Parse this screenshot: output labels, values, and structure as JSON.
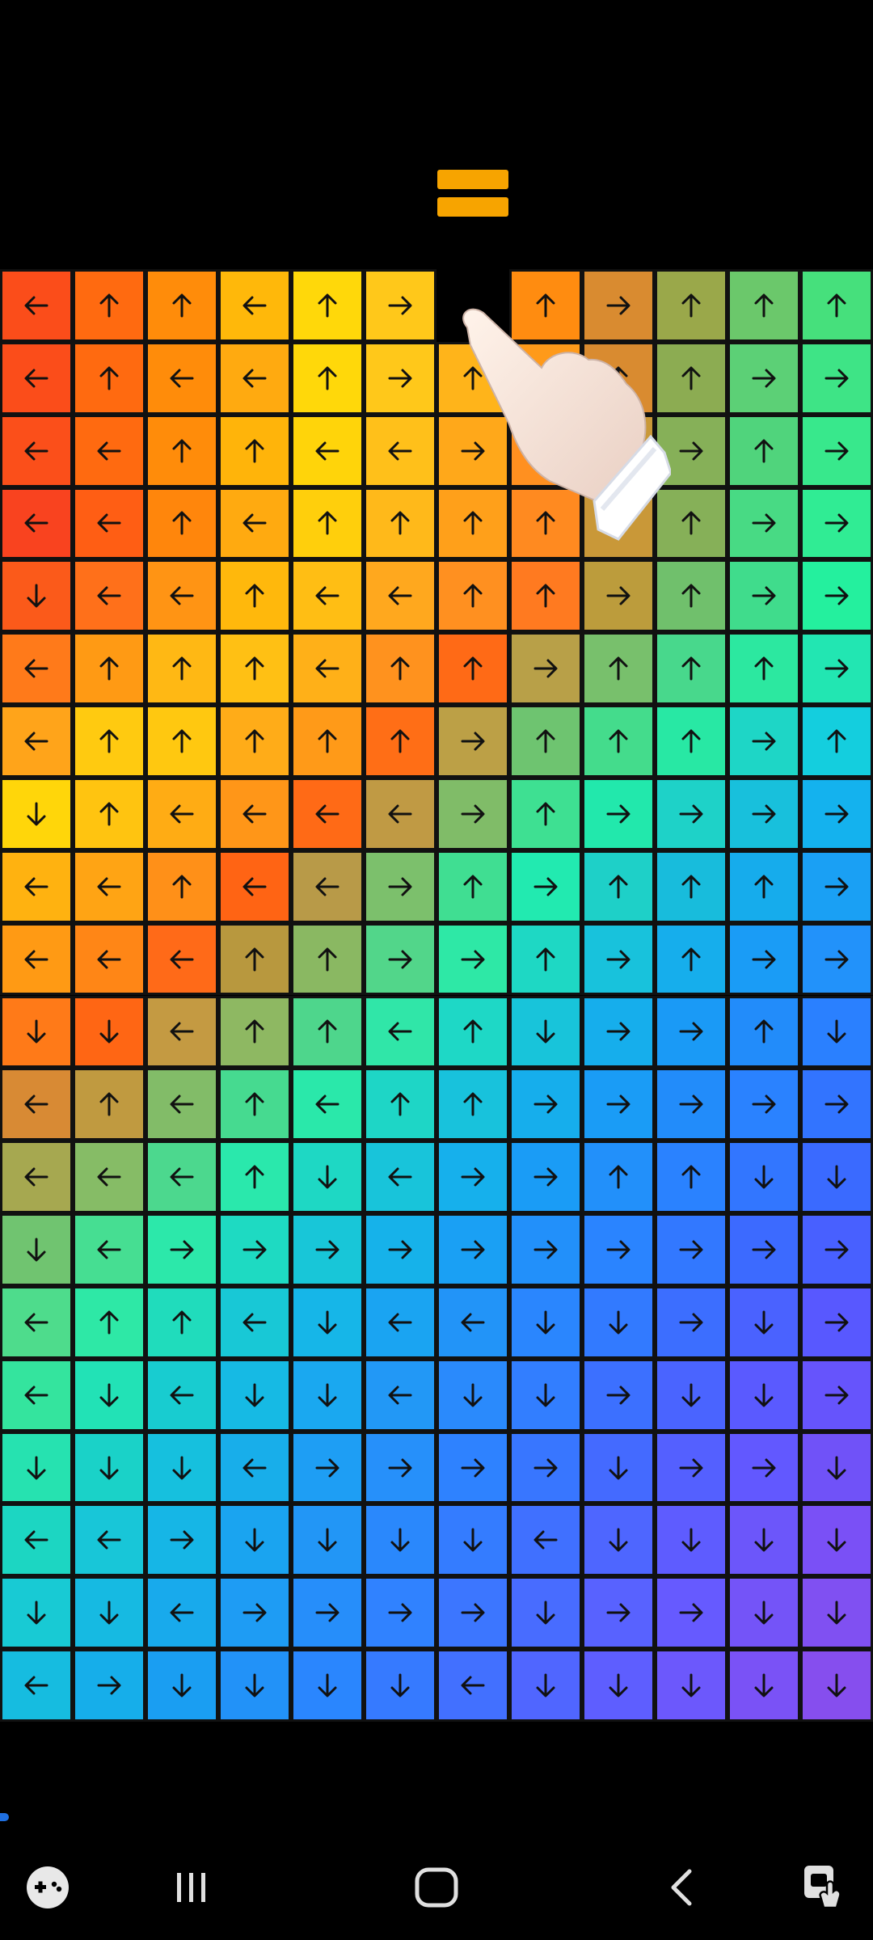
{
  "game": {
    "pause_icon": "pause-icon",
    "progress": 0.01,
    "hint_icon": "pointing-hand-icon",
    "grid": {
      "rows": 20,
      "cols": 12,
      "empty_cell": [
        0,
        6
      ],
      "arrows": [
        [
          "L",
          "U",
          "U",
          "L",
          "U",
          "R",
          "",
          "U",
          "R",
          "U",
          "U",
          "U"
        ],
        [
          "L",
          "U",
          "L",
          "L",
          "U",
          "R",
          "U",
          "U",
          "U",
          "U",
          "R",
          "R"
        ],
        [
          "L",
          "L",
          "U",
          "U",
          "L",
          "L",
          "R",
          "U",
          "L",
          "R",
          "U",
          "R"
        ],
        [
          "L",
          "L",
          "U",
          "L",
          "U",
          "U",
          "U",
          "U",
          "R",
          "U",
          "R",
          "R"
        ],
        [
          "D",
          "L",
          "L",
          "U",
          "L",
          "L",
          "U",
          "U",
          "R",
          "U",
          "R",
          "R"
        ],
        [
          "L",
          "U",
          "U",
          "U",
          "L",
          "U",
          "U",
          "R",
          "U",
          "U",
          "U",
          "R"
        ],
        [
          "L",
          "U",
          "U",
          "U",
          "U",
          "U",
          "R",
          "U",
          "U",
          "U",
          "R",
          "U"
        ],
        [
          "D",
          "U",
          "L",
          "L",
          "L",
          "L",
          "R",
          "U",
          "R",
          "R",
          "R",
          "R"
        ],
        [
          "L",
          "L",
          "U",
          "L",
          "L",
          "R",
          "U",
          "R",
          "U",
          "U",
          "U",
          "R"
        ],
        [
          "L",
          "L",
          "L",
          "U",
          "U",
          "R",
          "R",
          "U",
          "R",
          "U",
          "R",
          "R"
        ],
        [
          "D",
          "D",
          "L",
          "U",
          "U",
          "L",
          "U",
          "D",
          "R",
          "R",
          "U",
          "D"
        ],
        [
          "L",
          "U",
          "L",
          "U",
          "L",
          "U",
          "U",
          "R",
          "R",
          "R",
          "R",
          "R"
        ],
        [
          "L",
          "L",
          "L",
          "U",
          "D",
          "L",
          "R",
          "R",
          "U",
          "U",
          "D",
          "D"
        ],
        [
          "D",
          "L",
          "R",
          "R",
          "R",
          "R",
          "R",
          "R",
          "R",
          "R",
          "R",
          "R"
        ],
        [
          "L",
          "U",
          "U",
          "L",
          "D",
          "L",
          "L",
          "D",
          "D",
          "R",
          "D",
          "R"
        ],
        [
          "L",
          "D",
          "L",
          "D",
          "D",
          "L",
          "D",
          "D",
          "R",
          "D",
          "D",
          "R"
        ],
        [
          "D",
          "D",
          "D",
          "L",
          "R",
          "R",
          "R",
          "R",
          "D",
          "R",
          "R",
          "D"
        ],
        [
          "L",
          "L",
          "R",
          "D",
          "D",
          "D",
          "D",
          "L",
          "D",
          "D",
          "D",
          "D"
        ],
        [
          "D",
          "D",
          "L",
          "R",
          "R",
          "R",
          "R",
          "D",
          "R",
          "R",
          "D",
          "D"
        ],
        [
          "L",
          "R",
          "D",
          "D",
          "D",
          "D",
          "L",
          "D",
          "D",
          "D",
          "D",
          "D"
        ]
      ],
      "colors": [
        [
          "#fb4d1a",
          "#ff6a10",
          "#ff8c0a",
          "#ffb80a",
          "#ffd80a",
          "#ffc81a",
          "",
          "#ff8c10",
          "#d98b30",
          "#9aa84a",
          "#6bc86b",
          "#46e07c"
        ],
        [
          "#fb4d1a",
          "#ff6a10",
          "#ff8c0a",
          "#ffaa10",
          "#ffd80a",
          "#ffc81a",
          "#ffb41a",
          "#ff9a1a",
          "#d98b30",
          "#8cac52",
          "#5cd076",
          "#3ee486"
        ],
        [
          "#fb4f1a",
          "#ff6a10",
          "#ff8c0a",
          "#ffb40a",
          "#ffd40a",
          "#ffc01a",
          "#ffa81a",
          "#ff9020",
          "#c99838",
          "#86b058",
          "#50d47c",
          "#38e88c"
        ],
        [
          "#f9431f",
          "#ff5e14",
          "#ff860c",
          "#ffaa10",
          "#ffcf0c",
          "#ffb91a",
          "#ffa01a",
          "#ff8a20",
          "#c99838",
          "#86b058",
          "#48da84",
          "#30ec94"
        ],
        [
          "#fb5a1a",
          "#ff701a",
          "#ff9414",
          "#ffb80c",
          "#ffbe14",
          "#ffa81e",
          "#ff9020",
          "#ff7a20",
          "#bc9c3c",
          "#70c06c",
          "#40dc8c",
          "#24f09e"
        ],
        [
          "#ff7a1a",
          "#ff9a14",
          "#ffb814",
          "#ffc014",
          "#ffb018",
          "#ff921e",
          "#ff6a16",
          "#b8a048",
          "#78c06c",
          "#48d88c",
          "#2ce8a0",
          "#22e6b2"
        ],
        [
          "#ffa41a",
          "#ffca10",
          "#ffc810",
          "#ffac18",
          "#ff9a18",
          "#ff6e16",
          "#bca046",
          "#6ec470",
          "#44dc8c",
          "#28e8a4",
          "#1ed6c6",
          "#14cede"
        ],
        [
          "#ffd60a",
          "#ffc410",
          "#ffac14",
          "#ff9618",
          "#ff6a16",
          "#c09a44",
          "#80bc68",
          "#3ee092",
          "#22e8ac",
          "#1ed2c8",
          "#18c0dc",
          "#14b2ee"
        ],
        [
          "#ffb210",
          "#ffa414",
          "#ff9018",
          "#ff6414",
          "#b89a48",
          "#7cc06c",
          "#40de92",
          "#22eab0",
          "#1ed0c8",
          "#18bcdc",
          "#16acec",
          "#1aa0f4"
        ],
        [
          "#ff9a14",
          "#ff8616",
          "#ff6a18",
          "#b8983e",
          "#8ab862",
          "#52d68a",
          "#2ee8a6",
          "#1ed8c4",
          "#18c2dc",
          "#16aeec",
          "#1a9cf6",
          "#2292fa"
        ],
        [
          "#ff7a18",
          "#ff6614",
          "#c49a42",
          "#8eb862",
          "#4ed68c",
          "#30e6a8",
          "#1ed8c6",
          "#18c4da",
          "#16aeec",
          "#1a9af6",
          "#228cfa",
          "#2a80ff"
        ],
        [
          "#d88a34",
          "#c09a40",
          "#82bc68",
          "#46da90",
          "#2ae8aa",
          "#1ed6c6",
          "#18c2dc",
          "#16aeec",
          "#1a9cf6",
          "#228cfa",
          "#2a82ff",
          "#3274ff"
        ],
        [
          "#a6a850",
          "#86bc66",
          "#4cd88e",
          "#2ae8ac",
          "#1ed8c4",
          "#18c4da",
          "#16b0ec",
          "#1a9cf6",
          "#2290fa",
          "#2a82ff",
          "#3276ff",
          "#3a6aff"
        ],
        [
          "#70c470",
          "#46de92",
          "#2ce8aa",
          "#1edac2",
          "#18c6d8",
          "#16b2ea",
          "#1aa0f4",
          "#2290fa",
          "#2a84ff",
          "#3278ff",
          "#3c6aff",
          "#4860ff"
        ],
        [
          "#4edc8c",
          "#2ee8a6",
          "#20dcbc",
          "#18c8d6",
          "#16b6e8",
          "#1aa4f2",
          "#2294f8",
          "#2a86fe",
          "#327aff",
          "#3c6eff",
          "#4a62ff",
          "#5858ff"
        ],
        [
          "#34e49e",
          "#22e2b6",
          "#18ccd0",
          "#16bae4",
          "#1aa8f0",
          "#2298f6",
          "#2a8afc",
          "#327eff",
          "#3c70ff",
          "#4a64ff",
          "#5a5aff",
          "#6654fc"
        ],
        [
          "#26e2b0",
          "#1ad2c8",
          "#16c0de",
          "#18aeea",
          "#1e9ef4",
          "#2690fa",
          "#2e82ff",
          "#3876ff",
          "#446aff",
          "#5460ff",
          "#6258ff",
          "#7052f8"
        ],
        [
          "#1cd6c2",
          "#18c6d8",
          "#16b6e6",
          "#1aa4f0",
          "#2296f6",
          "#2a88fc",
          "#347cff",
          "#4070ff",
          "#4e66ff",
          "#5e5cff",
          "#6c56fa",
          "#7a50f6"
        ],
        [
          "#18cad4",
          "#16bae2",
          "#18aaec",
          "#1e9cf4",
          "#268efa",
          "#3082ff",
          "#3c76ff",
          "#486cff",
          "#5862ff",
          "#665aff",
          "#7454f8",
          "#8050f2"
        ],
        [
          "#16bce0",
          "#16aeea",
          "#1a9ef2",
          "#2292f8",
          "#2a86fe",
          "#367aff",
          "#4270ff",
          "#5066ff",
          "#5e5eff",
          "#6c58fc",
          "#7a52f6",
          "#864eee"
        ]
      ]
    }
  },
  "navbar": {
    "left_icon": "game-controller-icon",
    "recents_icon": "recent-apps-icon",
    "home_icon": "home-icon",
    "back_icon": "back-icon",
    "right_icon": "screen-touch-icon"
  }
}
